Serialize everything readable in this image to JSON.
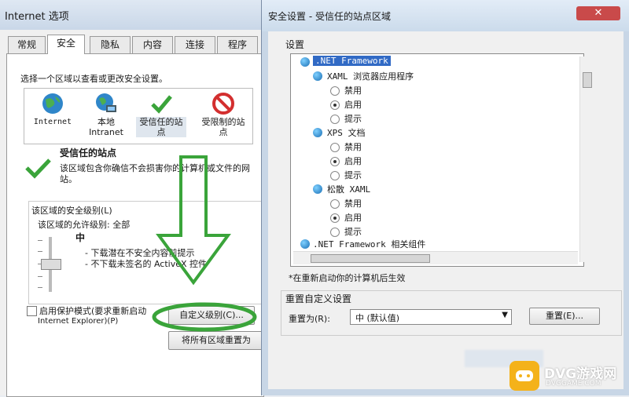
{
  "left_window": {
    "title": "Internet 选项",
    "tabs": [
      "常规",
      "安全",
      "隐私",
      "内容",
      "连接",
      "程序"
    ],
    "active_tab": "安全",
    "instruction": "选择一个区域以查看或更改安全设置。",
    "zones": [
      {
        "name": "Internet",
        "icon": "globe-icon"
      },
      {
        "name": "本地\nIntranet",
        "icon": "intranet-icon"
      },
      {
        "name": "受信任的站\n点",
        "icon": "checkmark-icon"
      },
      {
        "name": "受限制的站\n点",
        "icon": "restricted-icon"
      }
    ],
    "selected_zone_title": "受信任的站点",
    "selected_zone_desc": "该区域包含你确信不会损害你的计算机或文件的网站。",
    "security_level_group": "该区域的安全级别(L)",
    "allowed_level": "该区域的允许级别: 全部",
    "current_level": "中",
    "bullets": [
      "- 下载潜在不安全内容前提示",
      "- 不下载未签名的 ActiveX 控件"
    ],
    "protected_mode_label": "启用保护模式(要求重新启动",
    "protected_mode_label2": "Internet Explorer)(P)",
    "custom_level_button": "自定义级别(C)...",
    "reset_all_button": "将所有区域重置为"
  },
  "right_window": {
    "title": "安全设置 - 受信任的站点区域",
    "settings_label": "设置",
    "tree": [
      {
        "type": "header",
        "text": ".NET Framework"
      },
      {
        "type": "group",
        "text": "XAML 浏览器应用程序"
      },
      {
        "type": "option",
        "text": "禁用",
        "checked": false
      },
      {
        "type": "option",
        "text": "启用",
        "checked": true
      },
      {
        "type": "option",
        "text": "提示",
        "checked": false
      },
      {
        "type": "group",
        "text": "XPS 文档"
      },
      {
        "type": "option",
        "text": "禁用",
        "checked": false
      },
      {
        "type": "option",
        "text": "启用",
        "checked": true
      },
      {
        "type": "option",
        "text": "提示",
        "checked": false
      },
      {
        "type": "group",
        "text": "松散 XAML"
      },
      {
        "type": "option",
        "text": "禁用",
        "checked": false
      },
      {
        "type": "option",
        "text": "启用",
        "checked": true
      },
      {
        "type": "option",
        "text": "提示",
        "checked": false
      },
      {
        "type": "header",
        "text": ".NET Framework 相关组件"
      }
    ],
    "restart_note": "*在重新启动你的计算机后生效",
    "reset_group": "重置自定义设置",
    "reset_to_label": "重置为(R):",
    "reset_to_value": "中 (默认值)",
    "reset_button": "重置(E)..."
  },
  "colors": {
    "annotation_green": "#3aa43a",
    "titlebar": "#cbdbeb",
    "selection": "#316ac5"
  },
  "watermark": {
    "text": "DVG游戏网",
    "subtext": "DVGGAME.COM"
  }
}
